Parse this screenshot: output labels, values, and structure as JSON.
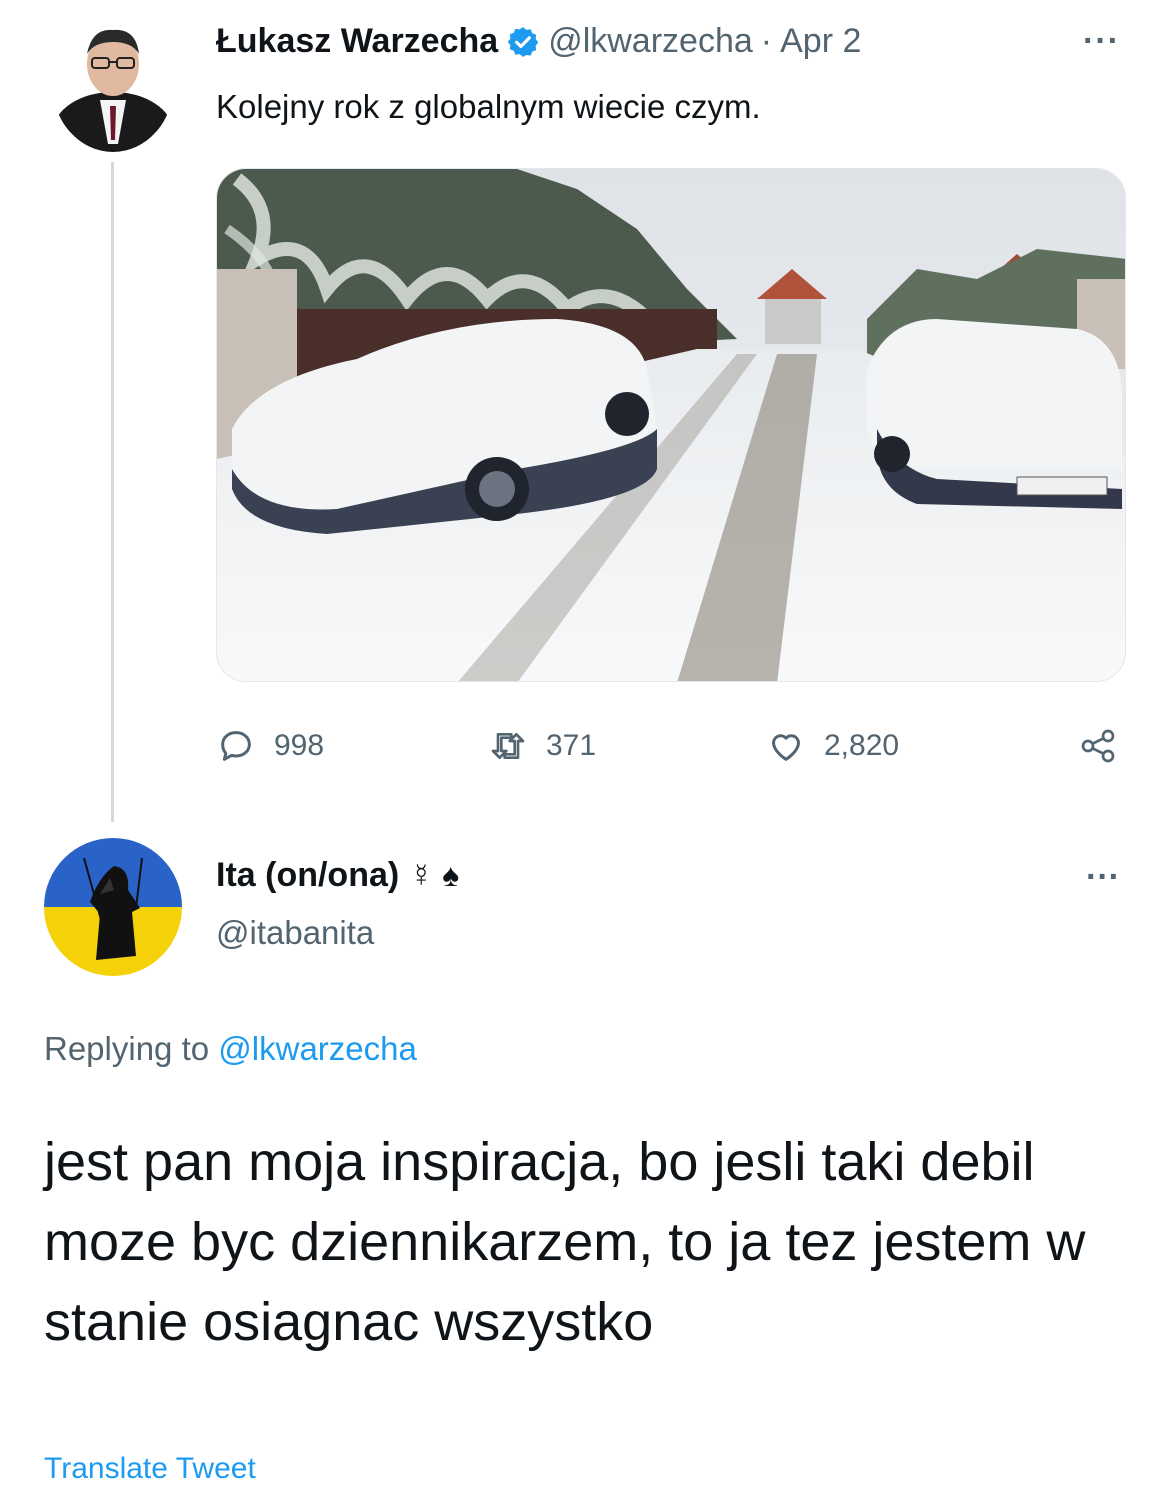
{
  "tweet": {
    "author_name": "Łukasz Warzecha",
    "handle": "@lkwarzecha",
    "separator": "·",
    "date": "Apr 2",
    "more": "···",
    "text": "Kolejny rok z globalnym wiecie czym.",
    "stats": {
      "replies": "998",
      "retweets": "371",
      "likes": "2,820"
    },
    "verified_color": "#1d9bf0"
  },
  "reply": {
    "author_name": "Ita (on/ona)",
    "name_symbols": "☿ ♠",
    "handle": "@itabanita",
    "more": "···",
    "replying_prefix": "Replying to",
    "replying_handle": "@lkwarzecha",
    "text": "jest pan moja inspiracja, bo jesli taki debil moze byc dziennikarzem, to ja tez jestem w stanie osiagnac wszystko",
    "translate": "Translate Tweet"
  },
  "icons": [
    "verified-icon",
    "reply-icon",
    "retweet-icon",
    "like-icon",
    "share-icon",
    "more-icon"
  ],
  "colors": {
    "link": "#1d9bf0",
    "muted": "#536471",
    "text": "#0f1419",
    "ukraine_blue": "#2a63c8",
    "ukraine_yellow": "#f5d10a"
  }
}
